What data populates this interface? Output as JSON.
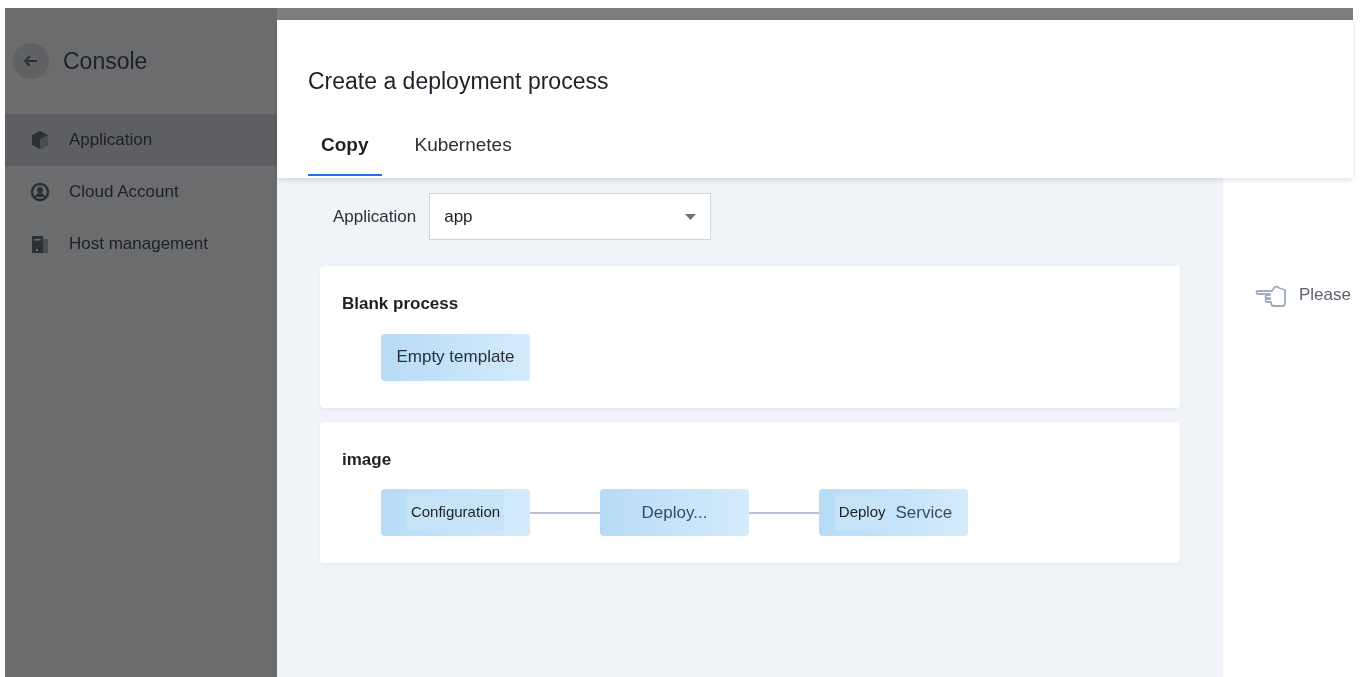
{
  "sidebar": {
    "title": "Console",
    "items": [
      {
        "label": "Application",
        "kind": "cube",
        "selected": true
      },
      {
        "label": "Cloud Account",
        "kind": "user",
        "selected": false
      },
      {
        "label": "Host management",
        "kind": "server",
        "selected": false
      }
    ]
  },
  "dialog": {
    "title": "Create a deployment process",
    "tabs": [
      {
        "label": "Copy",
        "selected": true
      },
      {
        "label": "Kubernetes",
        "selected": false
      }
    ],
    "application_field": {
      "label": "Application",
      "value": "app"
    },
    "sections": [
      {
        "title": "Blank process",
        "nodes": [
          [
            {
              "text": "Empty template",
              "kind": "plain"
            }
          ]
        ]
      },
      {
        "title": "image",
        "nodes": [
          [
            {
              "text": "Configuration",
              "kind": "inner"
            }
          ],
          [
            {
              "text": "Deploy...",
              "kind": "outer"
            }
          ],
          [
            {
              "text": "Deploy",
              "kind": "inner"
            },
            {
              "text": "Service",
              "kind": "outer"
            }
          ]
        ]
      }
    ],
    "hint": "Please"
  }
}
